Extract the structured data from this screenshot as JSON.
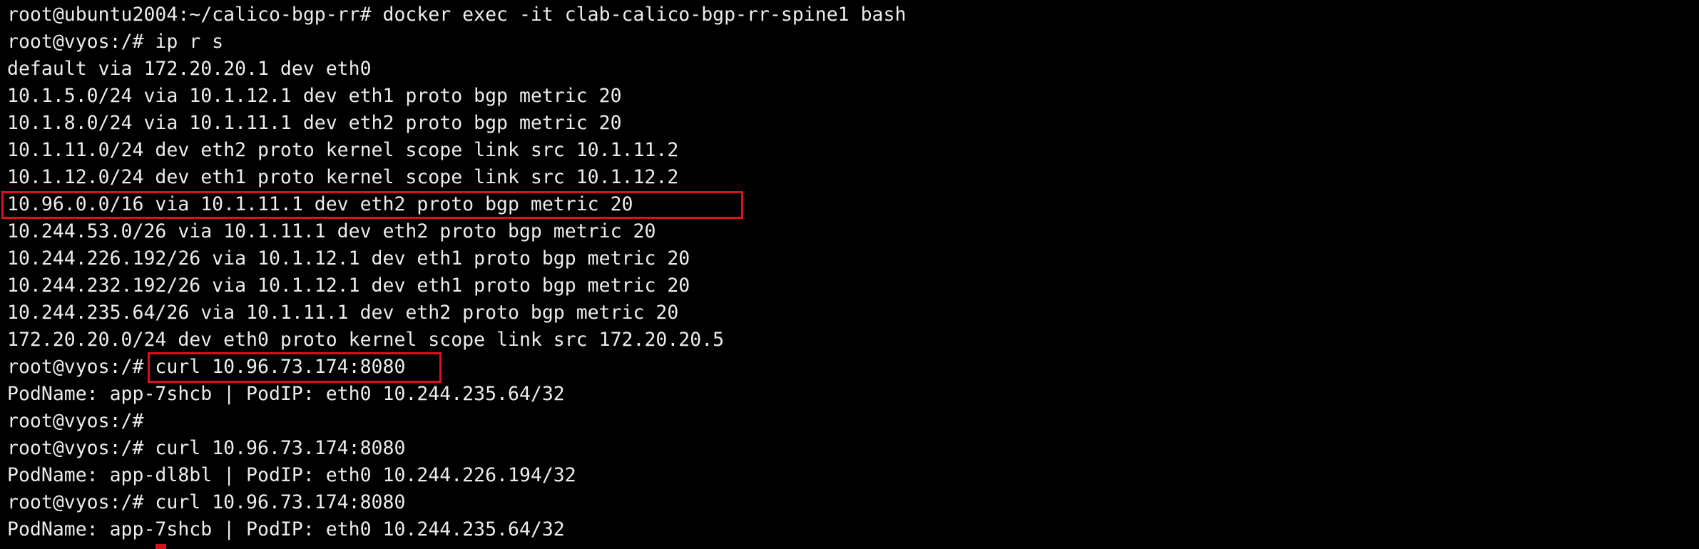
{
  "terminal": {
    "lines": [
      "root@ubuntu2004:~/calico-bgp-rr# docker exec -it clab-calico-bgp-rr-spine1 bash",
      "root@vyos:/# ip r s",
      "default via 172.20.20.1 dev eth0",
      "10.1.5.0/24 via 10.1.12.1 dev eth1 proto bgp metric 20",
      "10.1.8.0/24 via 10.1.11.1 dev eth2 proto bgp metric 20",
      "10.1.11.0/24 dev eth2 proto kernel scope link src 10.1.11.2",
      "10.1.12.0/24 dev eth1 proto kernel scope link src 10.1.12.2",
      "10.96.0.0/16 via 10.1.11.1 dev eth2 proto bgp metric 20",
      "10.244.53.0/26 via 10.1.11.1 dev eth2 proto bgp metric 20",
      "10.244.226.192/26 via 10.1.12.1 dev eth1 proto bgp metric 20",
      "10.244.232.192/26 via 10.1.12.1 dev eth1 proto bgp metric 20",
      "10.244.235.64/26 via 10.1.11.1 dev eth2 proto bgp metric 20",
      "172.20.20.0/24 dev eth0 proto kernel scope link src 172.20.20.5",
      "root@vyos:/# curl 10.96.73.174:8080",
      "PodName: app-7shcb | PodIP: eth0 10.244.235.64/32",
      "root@vyos:/#",
      "root@vyos:/# curl 10.96.73.174:8080",
      "PodName: app-dl8bl | PodIP: eth0 10.244.226.194/32",
      "root@vyos:/# curl 10.96.73.174:8080",
      "PodName: app-7shcb | PodIP: eth0 10.244.235.64/32"
    ]
  },
  "colors": {
    "background": "#000000",
    "text": "#ececec",
    "highlight": "#e0101a"
  }
}
